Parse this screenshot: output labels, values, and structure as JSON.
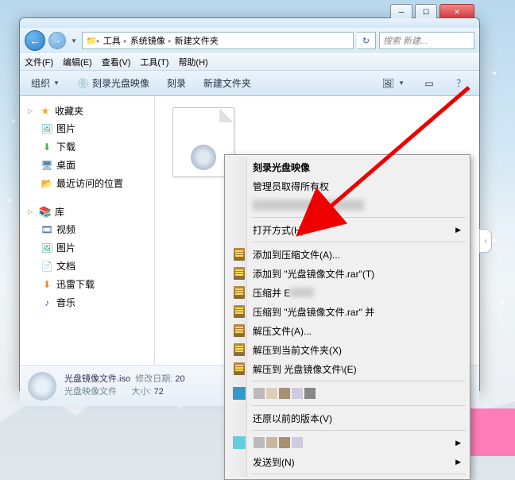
{
  "path": {
    "seg1": "工具",
    "seg2": "系统镜像",
    "seg3": "新建文件夹"
  },
  "search_placeholder": "搜索 新建...",
  "menubar": {
    "file": "文件(F)",
    "edit": "编辑(E)",
    "view": "查看(V)",
    "tools": "工具(T)",
    "help": "帮助(H)"
  },
  "toolbar": {
    "org": "组织",
    "burn": "刻录光盘映像",
    "burn2": "刻录",
    "newf": "新建文件夹"
  },
  "side": {
    "fav": "收藏夹",
    "pic": "图片",
    "dl": "下载",
    "desk": "桌面",
    "recent": "最近访问的位置",
    "lib": "库",
    "vid": "视频",
    "pic2": "图片",
    "doc": "文档",
    "xl": "迅雷下载",
    "music": "音乐"
  },
  "details": {
    "name": "光盘镜像文件.iso",
    "type": "光盘映像文件",
    "mod_l": "修改日期:",
    "mod_v": "20",
    "size_l": "大小:",
    "size_v": "72"
  },
  "ctx": {
    "burn": "刻录光盘映像",
    "admin": "管理员取得所有权",
    "open": "打开方式(H)",
    "addrar": "添加到压缩文件(A)...",
    "addto": "添加到 \"光盘镜像文件.rar\"(T)",
    "compm": "压缩并 E",
    "compto": "压缩到 \"光盘镜像文件.rar\" 并",
    "extract": "解压文件(A)...",
    "extcur": "解压到当前文件夹(X)",
    "extto": "解压到 光盘镜像文件\\(E)",
    "restore": "还原以前的版本(V)",
    "sendto": "发送到(N)"
  }
}
